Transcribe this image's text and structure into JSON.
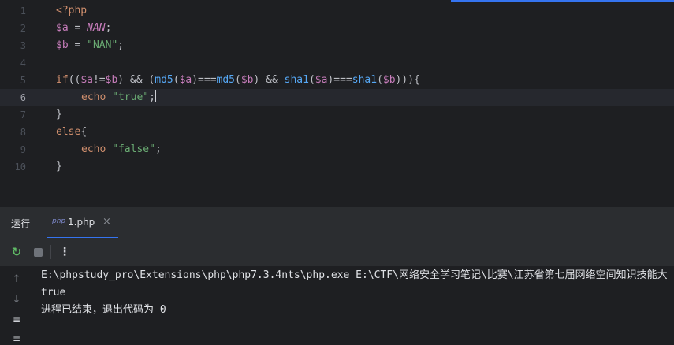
{
  "editor": {
    "current_line": 6,
    "lines": [
      {
        "no": "1",
        "tokens": [
          {
            "t": "<?php",
            "c": "c-tag"
          }
        ]
      },
      {
        "no": "2",
        "tokens": [
          {
            "t": "$a",
            "c": "c-var"
          },
          {
            "t": " = ",
            "c": ""
          },
          {
            "t": "NAN",
            "c": "c-const"
          },
          {
            "t": ";",
            "c": ""
          }
        ]
      },
      {
        "no": "3",
        "tokens": [
          {
            "t": "$b",
            "c": "c-var"
          },
          {
            "t": " = ",
            "c": ""
          },
          {
            "t": "\"NAN\"",
            "c": "c-str"
          },
          {
            "t": ";",
            "c": ""
          }
        ]
      },
      {
        "no": "4",
        "tokens": []
      },
      {
        "no": "5",
        "tokens": [
          {
            "t": "if",
            "c": "c-kw"
          },
          {
            "t": "((",
            "c": ""
          },
          {
            "t": "$a",
            "c": "c-var"
          },
          {
            "t": "!=",
            "c": ""
          },
          {
            "t": "$b",
            "c": "c-var"
          },
          {
            "t": ") && (",
            "c": ""
          },
          {
            "t": "md5",
            "c": "c-fn"
          },
          {
            "t": "(",
            "c": ""
          },
          {
            "t": "$a",
            "c": "c-var"
          },
          {
            "t": ")===",
            "c": ""
          },
          {
            "t": "md5",
            "c": "c-fn"
          },
          {
            "t": "(",
            "c": ""
          },
          {
            "t": "$b",
            "c": "c-var"
          },
          {
            "t": ") && ",
            "c": ""
          },
          {
            "t": "sha1",
            "c": "c-fn"
          },
          {
            "t": "(",
            "c": ""
          },
          {
            "t": "$a",
            "c": "c-var"
          },
          {
            "t": ")===",
            "c": ""
          },
          {
            "t": "sha1",
            "c": "c-fn"
          },
          {
            "t": "(",
            "c": ""
          },
          {
            "t": "$b",
            "c": "c-var"
          },
          {
            "t": "))){",
            "c": ""
          }
        ]
      },
      {
        "no": "6",
        "indent": true,
        "caret": true,
        "tokens": [
          {
            "t": "echo",
            "c": "c-kw"
          },
          {
            "t": " ",
            "c": ""
          },
          {
            "t": "\"true\"",
            "c": "c-str"
          },
          {
            "t": ";",
            "c": ""
          }
        ]
      },
      {
        "no": "7",
        "tokens": [
          {
            "t": "}",
            "c": ""
          }
        ]
      },
      {
        "no": "8",
        "tokens": [
          {
            "t": "else",
            "c": "c-kw"
          },
          {
            "t": "{",
            "c": ""
          }
        ]
      },
      {
        "no": "9",
        "indent": true,
        "tokens": [
          {
            "t": "echo",
            "c": "c-kw"
          },
          {
            "t": " ",
            "c": ""
          },
          {
            "t": "\"false\"",
            "c": "c-str"
          },
          {
            "t": ";",
            "c": ""
          }
        ]
      },
      {
        "no": "10",
        "tokens": [
          {
            "t": "}",
            "c": ""
          }
        ]
      }
    ]
  },
  "run_panel": {
    "title": "运行",
    "tab_label": "1.php",
    "php_icon_text": "php",
    "close_glyph": "×",
    "more_glyph": "⋮",
    "rerun_glyph": "↻",
    "side_icons": {
      "up": "↑",
      "down": "↓",
      "wrap": "≡"
    }
  },
  "console": {
    "lines": [
      "E:\\phpstudy_pro\\Extensions\\php\\php7.3.4nts\\php.exe E:\\CTF\\网络安全学习笔记\\比赛\\江苏省第七届网络空间知识技能大",
      "true",
      "进程已结束，退出代码为 0"
    ]
  },
  "colors": {
    "accent": "#3574f0",
    "editor_bg": "#1e1f22",
    "panel_bg": "#2b2d30"
  }
}
